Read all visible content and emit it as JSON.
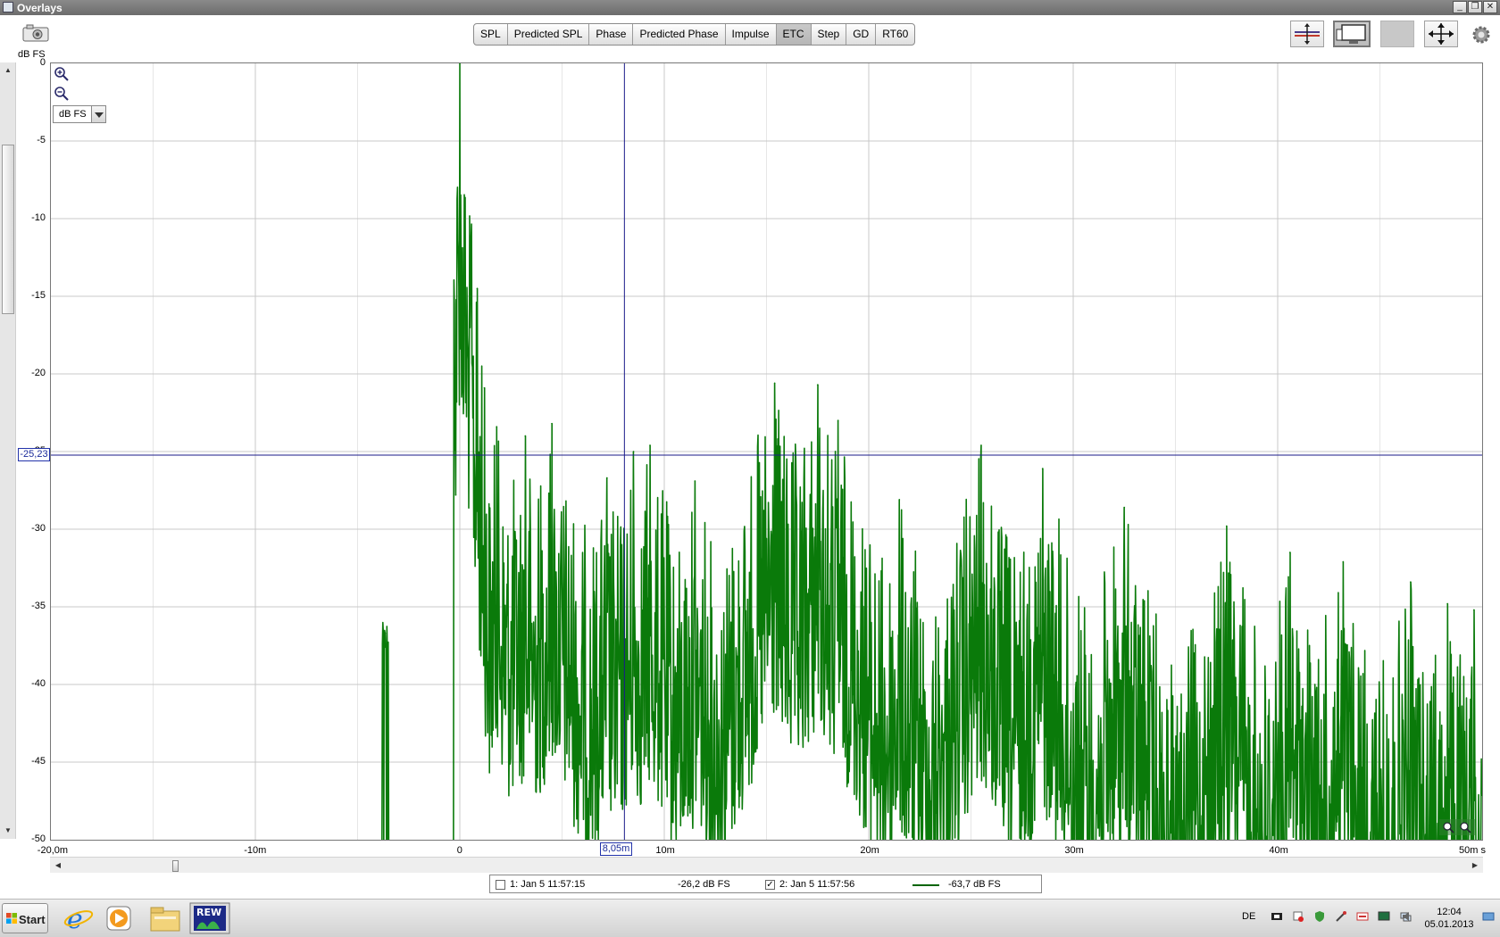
{
  "window": {
    "title": "Overlays"
  },
  "toolbar": {
    "y_unit_label": "dB FS",
    "tabs": [
      {
        "label": "SPL",
        "active": false
      },
      {
        "label": "Predicted SPL",
        "active": false
      },
      {
        "label": "Phase",
        "active": false
      },
      {
        "label": "Predicted Phase",
        "active": false
      },
      {
        "label": "Impulse",
        "active": false
      },
      {
        "label": "ETC",
        "active": true
      },
      {
        "label": "Step",
        "active": false
      },
      {
        "label": "GD",
        "active": false
      },
      {
        "label": "RT60",
        "active": false
      }
    ]
  },
  "controls": {
    "unit_select": "dB FS"
  },
  "cursor": {
    "x_label": "8,05m",
    "y_label": "-25,23",
    "x_value": 8.05,
    "y_value": -25.23
  },
  "chart_data": {
    "type": "line",
    "xlim": [
      -20,
      50
    ],
    "ylim": [
      -50,
      0
    ],
    "x_ticks": [
      -20,
      -10,
      0,
      10,
      20,
      30,
      40,
      50
    ],
    "x_tick_labels": [
      "-20,0m",
      "-10m",
      "0",
      "10m",
      "20m",
      "30m",
      "40m",
      "50m s"
    ],
    "y_ticks": [
      0,
      -5,
      -10,
      -15,
      -20,
      -25,
      -30,
      -35,
      -40,
      -45,
      -50
    ],
    "y_tick_labels": [
      "0",
      "-5",
      "-10",
      "-15",
      "-20",
      "-25",
      "-30",
      "-35",
      "-40",
      "-45",
      "-50"
    ],
    "grid": true,
    "series": [
      {
        "visible": true,
        "color": "#0a7a0a",
        "peaks": [
          {
            "x": -3.65,
            "y": -36.7
          },
          {
            "x": -0.2,
            "y": -27.8
          },
          {
            "x": 0,
            "y": 0
          },
          {
            "x": 0.25,
            "y": -9.2
          },
          {
            "x": 0.55,
            "y": -11.5
          },
          {
            "x": 0.85,
            "y": -14.5
          },
          {
            "x": 1.2,
            "y": -20.9
          },
          {
            "x": 1.8,
            "y": -23.4
          },
          {
            "x": 3.2,
            "y": -24.0
          },
          {
            "x": 4.5,
            "y": -23.2
          },
          {
            "x": 7.2,
            "y": -26.7
          },
          {
            "x": 8.5,
            "y": -25.0
          },
          {
            "x": 9.3,
            "y": -24.6
          },
          {
            "x": 11.5,
            "y": -26.9
          },
          {
            "x": 15.4,
            "y": -20.6
          },
          {
            "x": 17.5,
            "y": -20.7
          },
          {
            "x": 18.5,
            "y": -23.0
          },
          {
            "x": 21.5,
            "y": -28.1
          },
          {
            "x": 25.5,
            "y": -24.6
          },
          {
            "x": 28.5,
            "y": -26.1
          },
          {
            "x": 32.5,
            "y": -28.6
          },
          {
            "x": 37.5,
            "y": -29.8
          },
          {
            "x": 40.6,
            "y": -31.5
          },
          {
            "x": 43.2,
            "y": -32.1
          },
          {
            "x": 46.5,
            "y": -33.4
          },
          {
            "x": 48.3,
            "y": -34.8
          },
          {
            "x": 49.6,
            "y": -35.2
          }
        ]
      }
    ]
  },
  "legend": [
    {
      "label": "1: Jan 5 11:57:15",
      "value": "-26,2 dB FS",
      "checked": false,
      "color": "#8a0000"
    },
    {
      "label": "2: Jan 5 11:57:56",
      "value": "-63,7 dB FS",
      "checked": true,
      "color": "#006400"
    }
  ],
  "taskbar": {
    "start_label": "Start",
    "language": "DE",
    "time": "12:04",
    "date": "05.01.2013"
  },
  "icons": {
    "camera": "camera-icon",
    "zoom_in": "zoom-in-icon",
    "zoom_out": "zoom-out-icon",
    "settings": "gear-icon"
  }
}
